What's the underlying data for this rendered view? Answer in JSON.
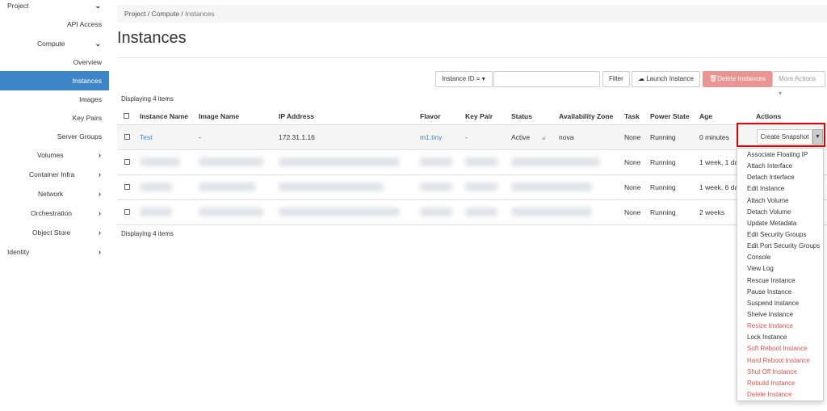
{
  "sidebar": {
    "project": "Project",
    "api_access": "API Access",
    "compute": "Compute",
    "overview": "Overview",
    "instances": "Instances",
    "images": "Images",
    "key_pairs": "Key Pairs",
    "server_groups": "Server Groups",
    "volumes": "Volumes",
    "container_infra": "Container Infra",
    "network": "Network",
    "orchestration": "Orchestration",
    "object_store": "Object Store",
    "identity": "Identity"
  },
  "breadcrumb": [
    "Project",
    "Compute",
    "Instances"
  ],
  "page_title": "Instances",
  "toolbar": {
    "filter_select": "Instance ID = ▾",
    "filter_value": "",
    "filter": "Filter",
    "launch": "Launch Instance",
    "delete": "Delete Instances",
    "more": "More Actions ▾"
  },
  "displaying": "Displaying 4 items",
  "columns": [
    "Instance Name",
    "Image Name",
    "IP Address",
    "Flavor",
    "Key Pair",
    "Status",
    "Availability Zone",
    "Task",
    "Power State",
    "Age",
    "Actions"
  ],
  "rows": [
    {
      "name": "Test",
      "image": "-",
      "ip": "172.31.1.16",
      "flavor": "m1.tiny",
      "key_pair": "-",
      "status": "Active",
      "az": "nova",
      "task": "None",
      "power": "Running",
      "age": "0 minutes"
    },
    {
      "task": "None",
      "power": "Running",
      "age": "1 week, 1 da"
    },
    {
      "task": "None",
      "power": "Running",
      "age": "1 week, 6 da"
    },
    {
      "task": "None",
      "power": "Running",
      "age": "2 weeks"
    }
  ],
  "actions": {
    "create_snapshot": "Create Snapshot",
    "menu": [
      {
        "label": "Associate Floating IP",
        "danger": false
      },
      {
        "label": "Attach Interface",
        "danger": false
      },
      {
        "label": "Detach Interface",
        "danger": false
      },
      {
        "label": "Edit Instance",
        "danger": false
      },
      {
        "label": "Attach Volume",
        "danger": false
      },
      {
        "label": "Detach Volume",
        "danger": false
      },
      {
        "label": "Update Metadata",
        "danger": false
      },
      {
        "label": "Edit Security Groups",
        "danger": false
      },
      {
        "label": "Edit Port Security Groups",
        "danger": false
      },
      {
        "label": "Console",
        "danger": false
      },
      {
        "label": "View Log",
        "danger": false
      },
      {
        "label": "Rescue Instance",
        "danger": false
      },
      {
        "label": "Pause Instance",
        "danger": false
      },
      {
        "label": "Suspend Instance",
        "danger": false
      },
      {
        "label": "Shelve Instance",
        "danger": false
      },
      {
        "label": "Resize Instance",
        "danger": true
      },
      {
        "label": "Lock Instance",
        "danger": false
      },
      {
        "label": "Soft Reboot Instance",
        "danger": true
      },
      {
        "label": "Hard Reboot Instance",
        "danger": true
      },
      {
        "label": "Shut Off Instance",
        "danger": true
      },
      {
        "label": "Rebuild Instance",
        "danger": true
      },
      {
        "label": "Delete Instance",
        "danger": true
      }
    ]
  },
  "colors": {
    "accent": "#3f86c9",
    "danger": "#d9534f",
    "highlight": "#e00000"
  }
}
